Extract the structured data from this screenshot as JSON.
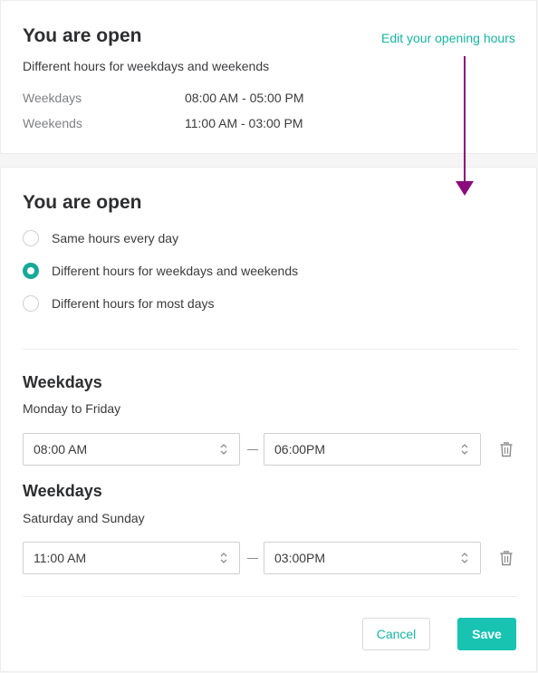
{
  "summary": {
    "title": "You are open",
    "edit_link": "Edit your opening hours",
    "mode_text": "Different hours for weekdays and weekends",
    "rows": [
      {
        "label": "Weekdays",
        "hours": "08:00 AM - 05:00 PM"
      },
      {
        "label": "Weekends",
        "hours": "11:00 AM - 03:00 PM"
      }
    ]
  },
  "editor": {
    "title": "You are open",
    "options": [
      {
        "label": "Same hours every day",
        "checked": false
      },
      {
        "label": "Different hours for weekdays and weekends",
        "checked": true
      },
      {
        "label": "Different hours for most days",
        "checked": false
      }
    ],
    "groups": [
      {
        "title": "Weekdays",
        "subtitle": "Monday to Friday",
        "open": "08:00 AM",
        "close": "06:00PM"
      },
      {
        "title": "Weekdays",
        "subtitle": "Saturday and Sunday",
        "open": "11:00 AM",
        "close": "03:00PM"
      }
    ],
    "cancel_label": "Cancel",
    "save_label": "Save"
  },
  "colors": {
    "accent": "#18c3b1",
    "arrow": "#8a0c7a",
    "muted": "#7f8084"
  },
  "icons": {
    "select_chevron": "chevron-updown-icon",
    "delete": "trash-icon",
    "annotation": "arrow-down-icon"
  }
}
